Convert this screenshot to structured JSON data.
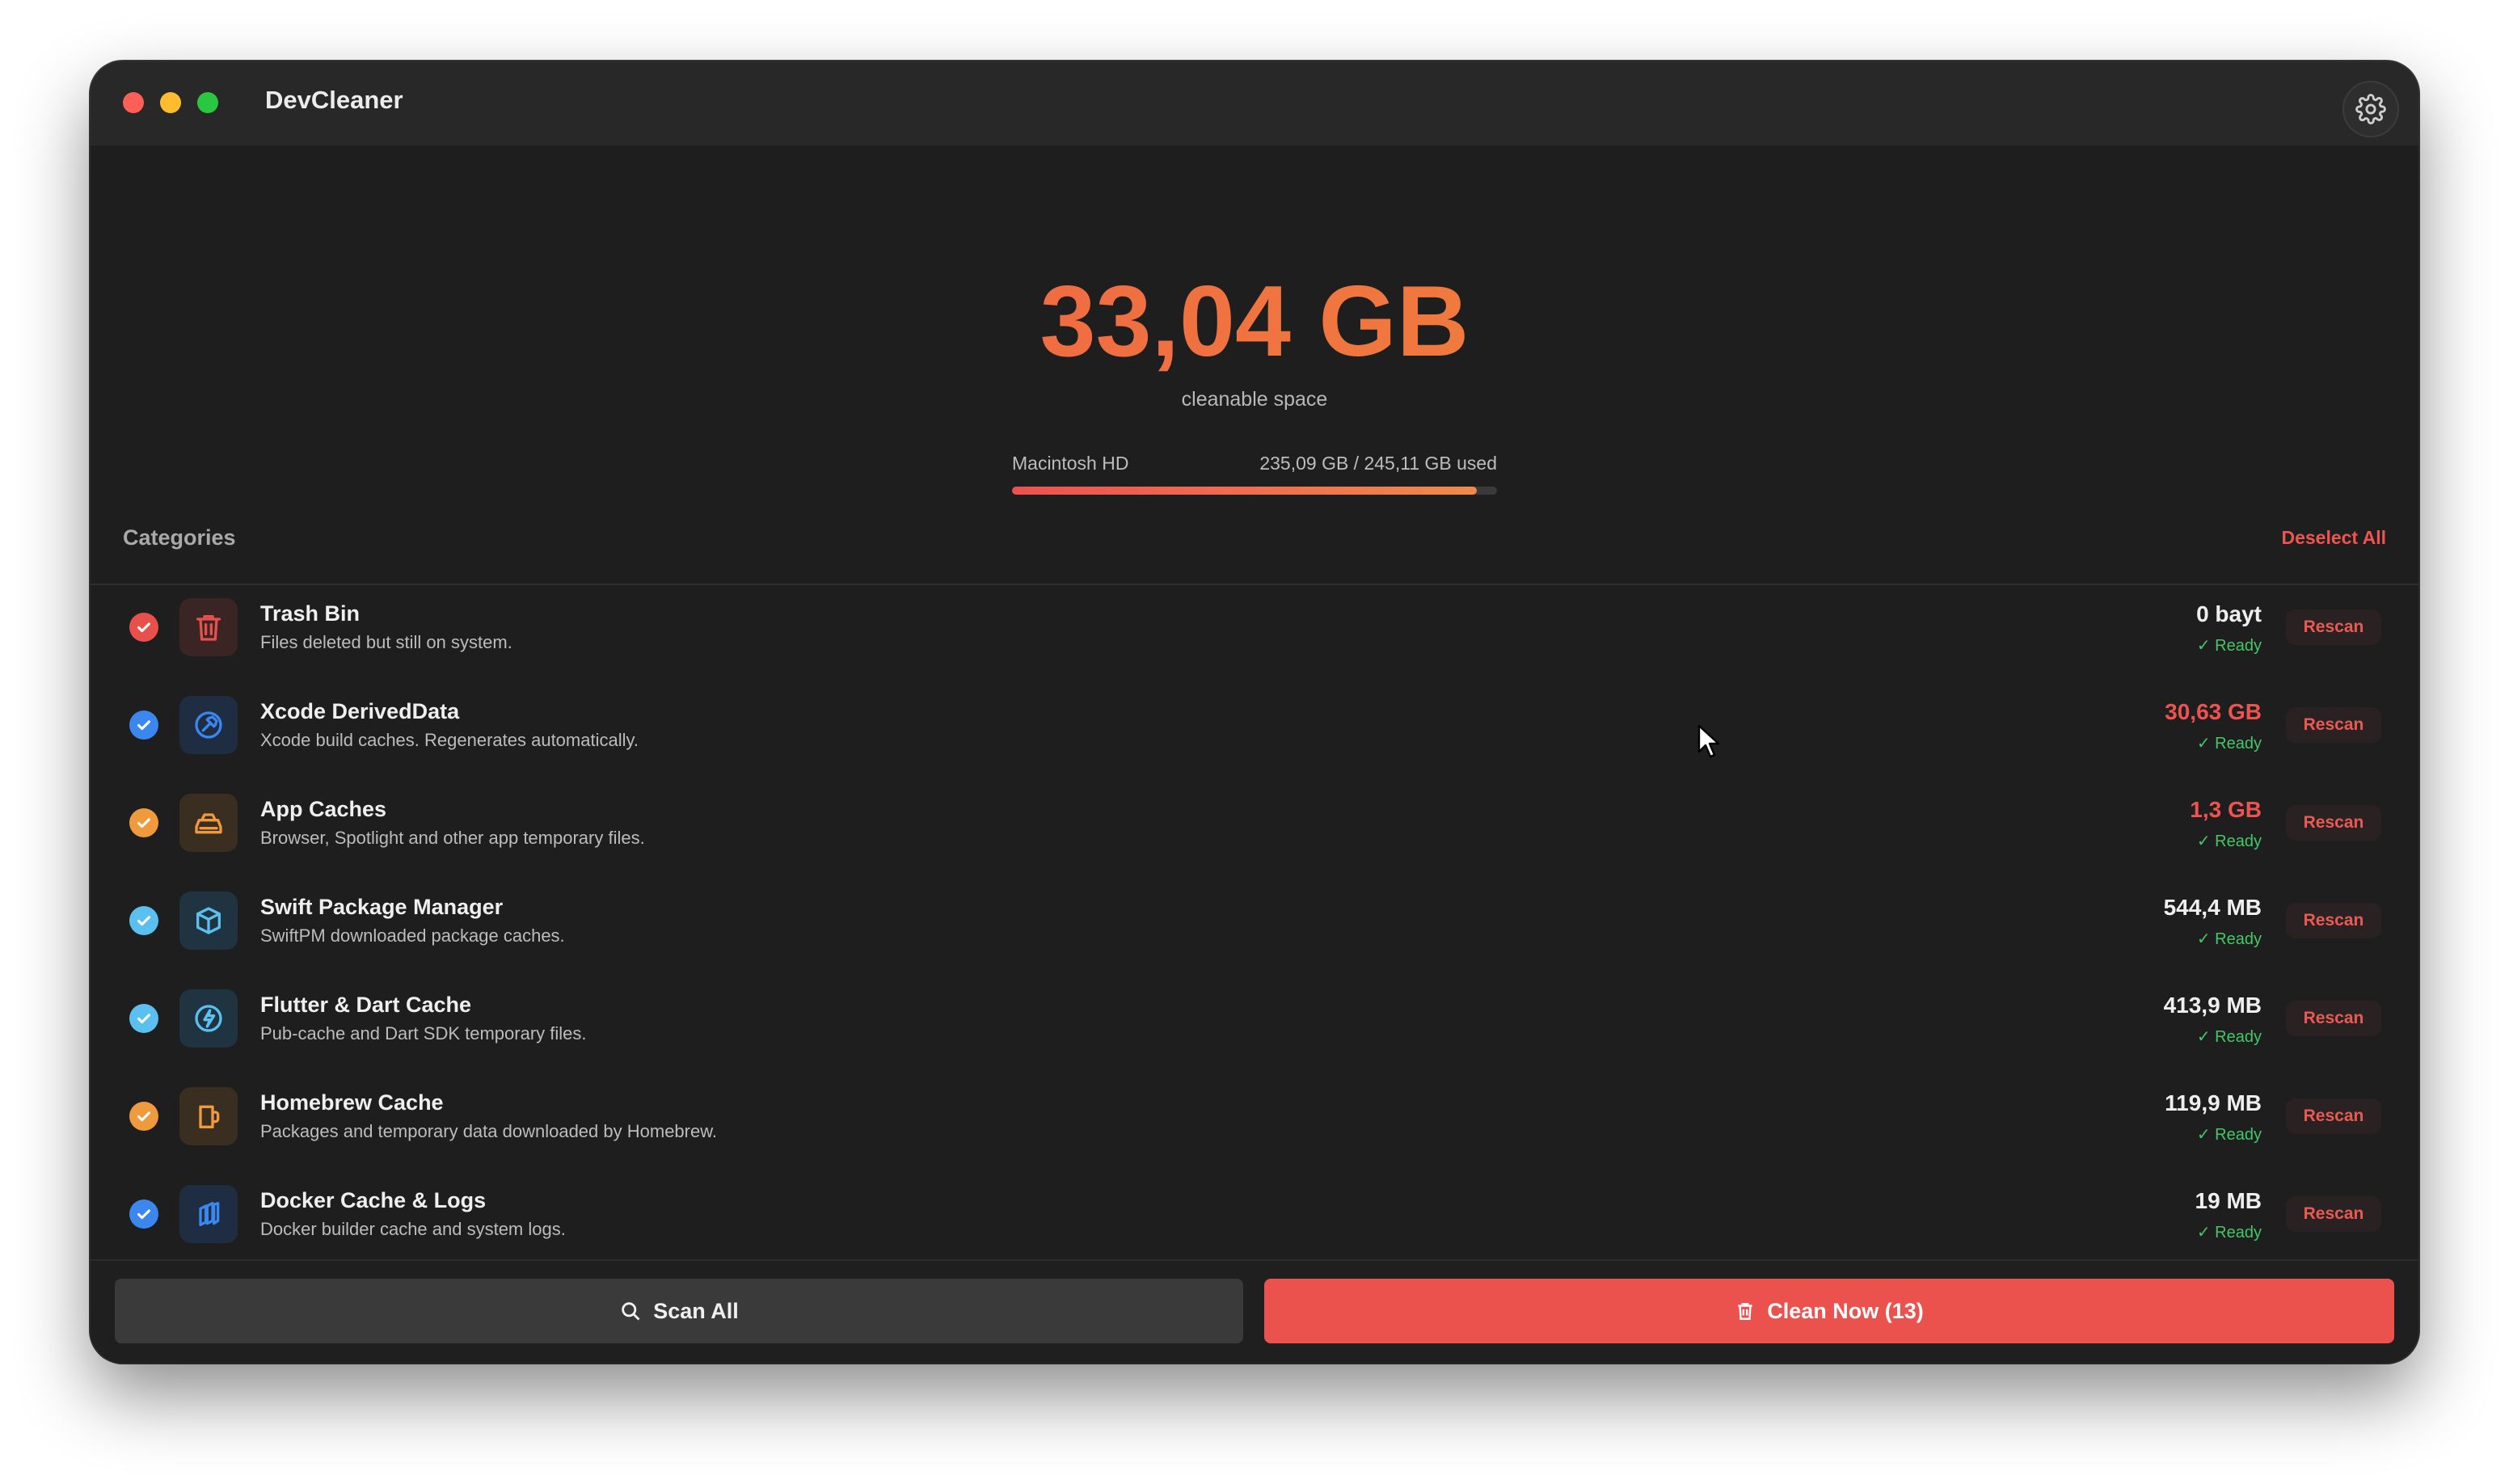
{
  "app": {
    "title": "DevCleaner"
  },
  "summary": {
    "total": "33,04 GB",
    "total_label": "cleanable space",
    "disk_name": "Macintosh HD",
    "disk_usage": "235,09 GB / 245,11 GB used",
    "disk_used_fraction": 0.959
  },
  "categories_header": {
    "title": "Categories",
    "deselect_label": "Deselect All"
  },
  "categories": [
    {
      "title": "Trash Bin",
      "desc": "Files deleted but still on system.",
      "size": "0 bayt",
      "status": "✓  Ready",
      "rescan": "Rescan",
      "icon": "trash-icon",
      "check_color": "#e8504c",
      "icon_color": "#e8504c",
      "icon_bg": "#3a2424",
      "size_color": "#efefef"
    },
    {
      "title": "Xcode DerivedData",
      "desc": "Xcode build caches. Regenerates automatically.",
      "size": "30,63 GB",
      "status": "✓  Ready",
      "rescan": "Rescan",
      "icon": "hammer-icon",
      "check_color": "#3a87f0",
      "icon_color": "#3a87f0",
      "icon_bg": "#1f2d42",
      "size_color": "#ee5350"
    },
    {
      "title": "App Caches",
      "desc": "Browser, Spotlight and other app temporary files.",
      "size": "1,3 GB",
      "status": "✓  Ready",
      "rescan": "Rescan",
      "icon": "drive-icon",
      "check_color": "#f09a3e",
      "icon_color": "#f09a3e",
      "icon_bg": "#3a2e20",
      "size_color": "#ee5350"
    },
    {
      "title": "Swift Package Manager",
      "desc": "SwiftPM downloaded package caches.",
      "size": "544,4 MB",
      "status": "✓  Ready",
      "rescan": "Rescan",
      "icon": "package-icon",
      "check_color": "#5bc0f0",
      "icon_color": "#5bc0f0",
      "icon_bg": "#1f3340",
      "size_color": "#efefef"
    },
    {
      "title": "Flutter & Dart Cache",
      "desc": "Pub-cache and Dart SDK temporary files.",
      "size": "413,9 MB",
      "status": "✓  Ready",
      "rescan": "Rescan",
      "icon": "bolt-icon",
      "check_color": "#5bc0f0",
      "icon_color": "#5bc0f0",
      "icon_bg": "#1f3340",
      "size_color": "#efefef"
    },
    {
      "title": "Homebrew Cache",
      "desc": "Packages and temporary data downloaded by Homebrew.",
      "size": "119,9 MB",
      "status": "✓  Ready",
      "rescan": "Rescan",
      "icon": "mug-icon",
      "check_color": "#f09a3e",
      "icon_color": "#f09a3e",
      "icon_bg": "#3a2e20",
      "size_color": "#efefef"
    },
    {
      "title": "Docker Cache & Logs",
      "desc": "Docker builder cache and system logs.",
      "size": "19 MB",
      "status": "✓  Ready",
      "rescan": "Rescan",
      "icon": "cube-stack-icon",
      "check_color": "#3a87f0",
      "icon_color": "#3a87f0",
      "icon_bg": "#1f2d42",
      "size_color": "#efefef"
    }
  ],
  "footer": {
    "scan_label": "Scan All",
    "clean_label": "Clean Now (13)"
  }
}
